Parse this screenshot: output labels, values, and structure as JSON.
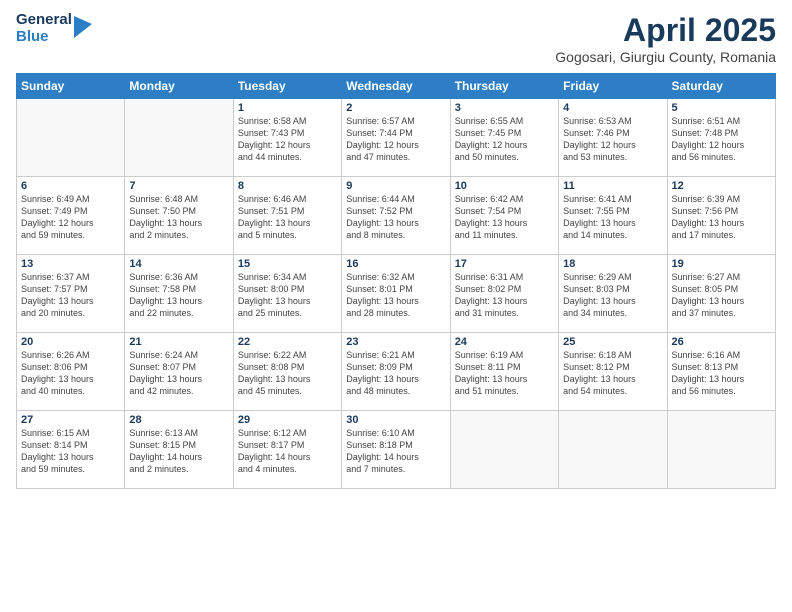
{
  "header": {
    "logo_general": "General",
    "logo_blue": "Blue",
    "title": "April 2025",
    "subtitle": "Gogosari, Giurgiu County, Romania"
  },
  "days_of_week": [
    "Sunday",
    "Monday",
    "Tuesday",
    "Wednesday",
    "Thursday",
    "Friday",
    "Saturday"
  ],
  "weeks": [
    [
      {
        "day": "",
        "info": ""
      },
      {
        "day": "",
        "info": ""
      },
      {
        "day": "1",
        "info": "Sunrise: 6:58 AM\nSunset: 7:43 PM\nDaylight: 12 hours\nand 44 minutes."
      },
      {
        "day": "2",
        "info": "Sunrise: 6:57 AM\nSunset: 7:44 PM\nDaylight: 12 hours\nand 47 minutes."
      },
      {
        "day": "3",
        "info": "Sunrise: 6:55 AM\nSunset: 7:45 PM\nDaylight: 12 hours\nand 50 minutes."
      },
      {
        "day": "4",
        "info": "Sunrise: 6:53 AM\nSunset: 7:46 PM\nDaylight: 12 hours\nand 53 minutes."
      },
      {
        "day": "5",
        "info": "Sunrise: 6:51 AM\nSunset: 7:48 PM\nDaylight: 12 hours\nand 56 minutes."
      }
    ],
    [
      {
        "day": "6",
        "info": "Sunrise: 6:49 AM\nSunset: 7:49 PM\nDaylight: 12 hours\nand 59 minutes."
      },
      {
        "day": "7",
        "info": "Sunrise: 6:48 AM\nSunset: 7:50 PM\nDaylight: 13 hours\nand 2 minutes."
      },
      {
        "day": "8",
        "info": "Sunrise: 6:46 AM\nSunset: 7:51 PM\nDaylight: 13 hours\nand 5 minutes."
      },
      {
        "day": "9",
        "info": "Sunrise: 6:44 AM\nSunset: 7:52 PM\nDaylight: 13 hours\nand 8 minutes."
      },
      {
        "day": "10",
        "info": "Sunrise: 6:42 AM\nSunset: 7:54 PM\nDaylight: 13 hours\nand 11 minutes."
      },
      {
        "day": "11",
        "info": "Sunrise: 6:41 AM\nSunset: 7:55 PM\nDaylight: 13 hours\nand 14 minutes."
      },
      {
        "day": "12",
        "info": "Sunrise: 6:39 AM\nSunset: 7:56 PM\nDaylight: 13 hours\nand 17 minutes."
      }
    ],
    [
      {
        "day": "13",
        "info": "Sunrise: 6:37 AM\nSunset: 7:57 PM\nDaylight: 13 hours\nand 20 minutes."
      },
      {
        "day": "14",
        "info": "Sunrise: 6:36 AM\nSunset: 7:58 PM\nDaylight: 13 hours\nand 22 minutes."
      },
      {
        "day": "15",
        "info": "Sunrise: 6:34 AM\nSunset: 8:00 PM\nDaylight: 13 hours\nand 25 minutes."
      },
      {
        "day": "16",
        "info": "Sunrise: 6:32 AM\nSunset: 8:01 PM\nDaylight: 13 hours\nand 28 minutes."
      },
      {
        "day": "17",
        "info": "Sunrise: 6:31 AM\nSunset: 8:02 PM\nDaylight: 13 hours\nand 31 minutes."
      },
      {
        "day": "18",
        "info": "Sunrise: 6:29 AM\nSunset: 8:03 PM\nDaylight: 13 hours\nand 34 minutes."
      },
      {
        "day": "19",
        "info": "Sunrise: 6:27 AM\nSunset: 8:05 PM\nDaylight: 13 hours\nand 37 minutes."
      }
    ],
    [
      {
        "day": "20",
        "info": "Sunrise: 6:26 AM\nSunset: 8:06 PM\nDaylight: 13 hours\nand 40 minutes."
      },
      {
        "day": "21",
        "info": "Sunrise: 6:24 AM\nSunset: 8:07 PM\nDaylight: 13 hours\nand 42 minutes."
      },
      {
        "day": "22",
        "info": "Sunrise: 6:22 AM\nSunset: 8:08 PM\nDaylight: 13 hours\nand 45 minutes."
      },
      {
        "day": "23",
        "info": "Sunrise: 6:21 AM\nSunset: 8:09 PM\nDaylight: 13 hours\nand 48 minutes."
      },
      {
        "day": "24",
        "info": "Sunrise: 6:19 AM\nSunset: 8:11 PM\nDaylight: 13 hours\nand 51 minutes."
      },
      {
        "day": "25",
        "info": "Sunrise: 6:18 AM\nSunset: 8:12 PM\nDaylight: 13 hours\nand 54 minutes."
      },
      {
        "day": "26",
        "info": "Sunrise: 6:16 AM\nSunset: 8:13 PM\nDaylight: 13 hours\nand 56 minutes."
      }
    ],
    [
      {
        "day": "27",
        "info": "Sunrise: 6:15 AM\nSunset: 8:14 PM\nDaylight: 13 hours\nand 59 minutes."
      },
      {
        "day": "28",
        "info": "Sunrise: 6:13 AM\nSunset: 8:15 PM\nDaylight: 14 hours\nand 2 minutes."
      },
      {
        "day": "29",
        "info": "Sunrise: 6:12 AM\nSunset: 8:17 PM\nDaylight: 14 hours\nand 4 minutes."
      },
      {
        "day": "30",
        "info": "Sunrise: 6:10 AM\nSunset: 8:18 PM\nDaylight: 14 hours\nand 7 minutes."
      },
      {
        "day": "",
        "info": ""
      },
      {
        "day": "",
        "info": ""
      },
      {
        "day": "",
        "info": ""
      }
    ]
  ]
}
